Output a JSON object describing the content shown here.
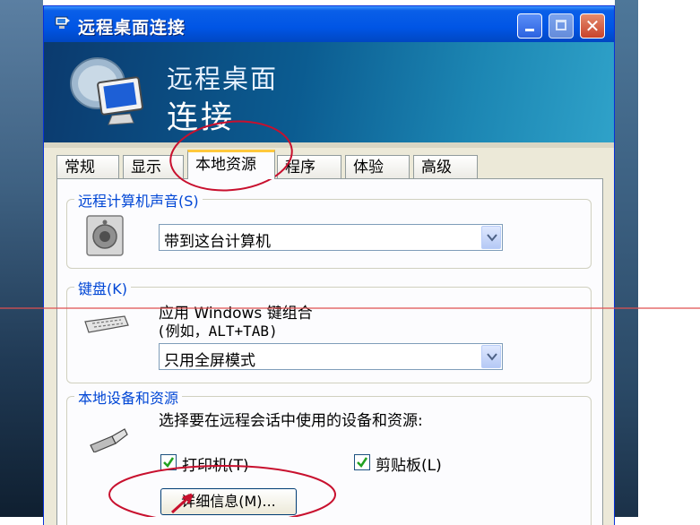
{
  "window": {
    "title": "远程桌面连接",
    "banner_line1": "远程桌面",
    "banner_line2": "连接",
    "close_glyph": "✕"
  },
  "tabs": [
    {
      "label": "常规",
      "active": false
    },
    {
      "label": "显示",
      "active": false
    },
    {
      "label": "本地资源",
      "active": true
    },
    {
      "label": "程序",
      "active": false
    },
    {
      "label": "体验",
      "active": false
    },
    {
      "label": "高级",
      "active": false
    }
  ],
  "sound": {
    "legend": "远程计算机声音(S)",
    "selected": "带到这台计算机",
    "icon": "speaker-icon"
  },
  "keyboard": {
    "legend": "键盘(K)",
    "desc_line1": "应用 Windows 键组合",
    "desc_line2": "(例如，ALT+TAB)",
    "selected": "只用全屏模式",
    "icon": "keyboard-icon"
  },
  "devices": {
    "legend": "本地设备和资源",
    "desc": "选择要在远程会话中使用的设备和资源:",
    "printer_label": "打印机(T)",
    "printer_checked": true,
    "clipboard_label": "剪贴板(L)",
    "clipboard_checked": true,
    "details_button": "详细信息(M)...",
    "icon": "usb-plug-icon"
  },
  "colors": {
    "titlebar": "#0055e5",
    "annotation_red": "#c8102e",
    "guide_line": "#e05050"
  }
}
